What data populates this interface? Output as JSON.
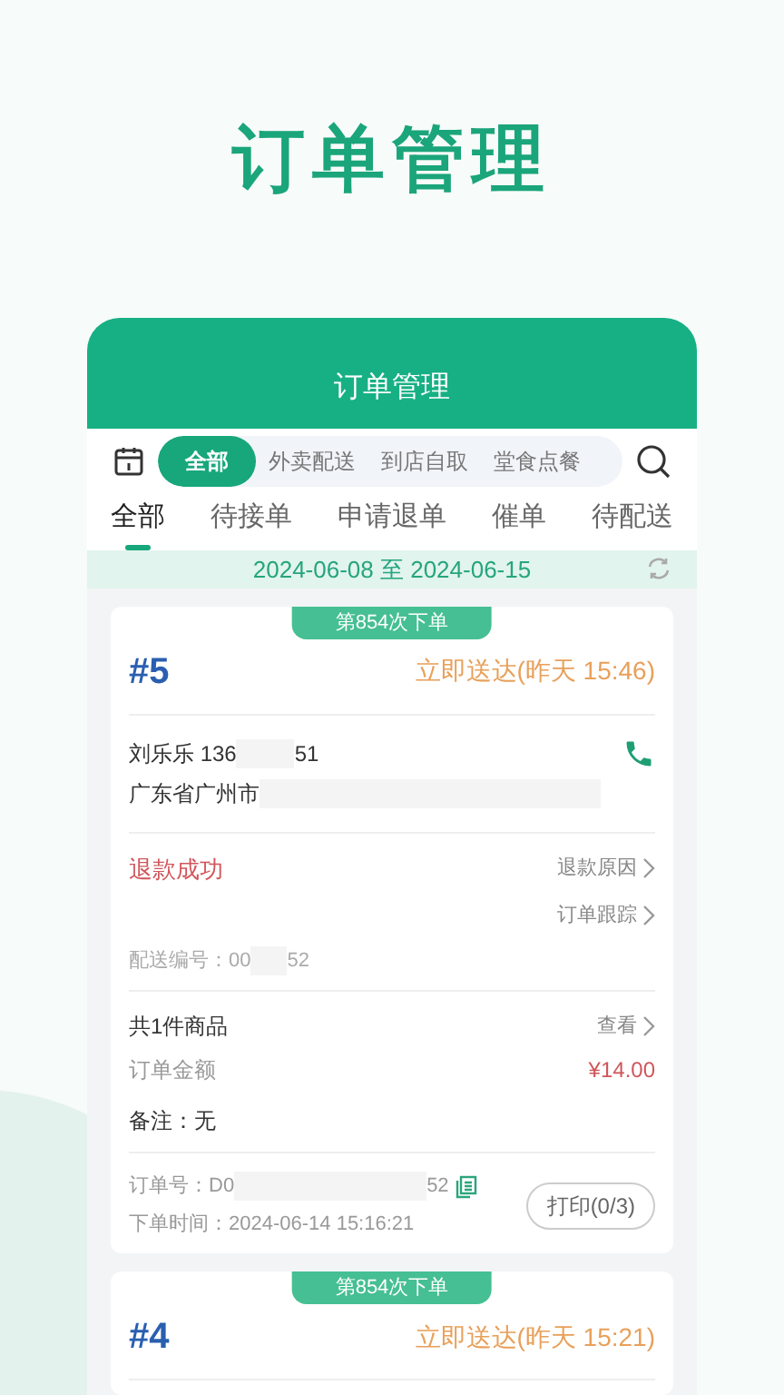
{
  "hero_title": "订单管理",
  "app": {
    "title": "订单管理",
    "order_types": [
      {
        "label": "全部",
        "selected": true
      },
      {
        "label": "外卖配送",
        "selected": false
      },
      {
        "label": "到店自取",
        "selected": false
      },
      {
        "label": "堂食点餐",
        "selected": false
      }
    ],
    "status_tabs": [
      {
        "label": "全部",
        "selected": true
      },
      {
        "label": "待接单",
        "selected": false
      },
      {
        "label": "申请退单",
        "selected": false
      },
      {
        "label": "催单",
        "selected": false
      },
      {
        "label": "待配送",
        "selected": false
      }
    ],
    "date_range": {
      "start": "2024-06-08",
      "separator": "至",
      "end": "2024-06-15"
    },
    "orders": [
      {
        "badge": "第854次下单",
        "number": "#5",
        "delivery": "立即送达(昨天 15:46)",
        "customer": "刘乐乐 136",
        "phone_suffix": "51",
        "address": "广东省广州市",
        "refund_status": "退款成功",
        "links": [
          "退款原因",
          "订单跟踪"
        ],
        "delivery_no": "配送编号：00",
        "delivery_no_suffix": "52",
        "items_count": "共1件商品",
        "view": "查看",
        "amount_label": "订单金额",
        "amount": "¥14.00",
        "remark": "备注：无",
        "order_no": "订单号：D0",
        "order_no_suffix": "52",
        "order_time": "下单时间：2024-06-14 15:16:21",
        "print": "打印(0/3)"
      },
      {
        "badge": "第854次下单",
        "number": "#4",
        "delivery": "立即送达(昨天 15:21)"
      }
    ]
  }
}
